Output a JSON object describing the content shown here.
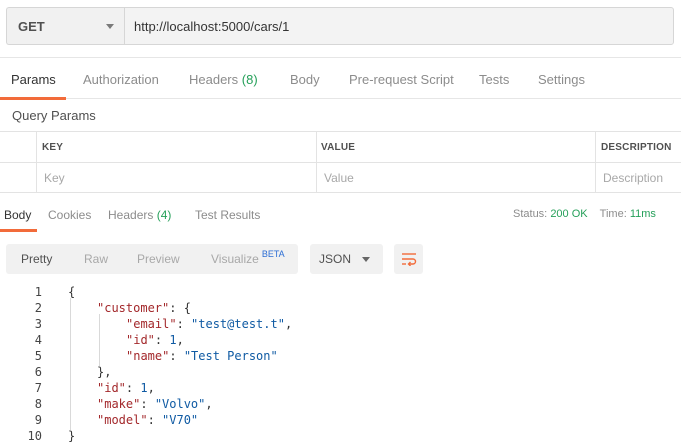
{
  "request": {
    "method": "GET",
    "url": "http://localhost:5000/cars/1"
  },
  "request_tabs": [
    {
      "label": "Params",
      "count": ""
    },
    {
      "label": "Authorization",
      "count": ""
    },
    {
      "label": "Headers",
      "count": "(8)"
    },
    {
      "label": "Body",
      "count": ""
    },
    {
      "label": "Pre-request Script",
      "count": ""
    },
    {
      "label": "Tests",
      "count": ""
    },
    {
      "label": "Settings",
      "count": ""
    }
  ],
  "query_params": {
    "title": "Query Params",
    "headers": [
      "KEY",
      "VALUE",
      "DESCRIPTION"
    ],
    "placeholders": [
      "Key",
      "Value",
      "Description"
    ]
  },
  "response_tabs": [
    {
      "label": "Body",
      "count": ""
    },
    {
      "label": "Cookies",
      "count": ""
    },
    {
      "label": "Headers",
      "count": "(4)"
    },
    {
      "label": "Test Results",
      "count": ""
    }
  ],
  "status": {
    "status_label": "Status:",
    "status_value": "200 OK",
    "time_label": "Time:",
    "time_value": "11ms"
  },
  "format": {
    "options": [
      "Pretty",
      "Raw",
      "Preview",
      "Visualize"
    ],
    "beta": "BETA",
    "selected_type": "JSON"
  },
  "icons": {
    "method_dropdown": "chevron-down-icon",
    "type_dropdown": "chevron-down-icon",
    "wrap": "wrap-lines-icon"
  },
  "colors": {
    "accent": "#f26b3a",
    "status_ok": "#26a05a",
    "beta": "#2d6ed4",
    "json_key": "#a3282b",
    "json_value": "#0f5aa3"
  },
  "code_lines": [
    {
      "n": "1",
      "indent": 0,
      "tokens": [
        {
          "t": "p",
          "v": "{"
        }
      ]
    },
    {
      "n": "2",
      "indent": 1,
      "tokens": [
        {
          "t": "k",
          "v": "\"customer\""
        },
        {
          "t": "p",
          "v": ": {"
        }
      ]
    },
    {
      "n": "3",
      "indent": 2,
      "tokens": [
        {
          "t": "k",
          "v": "\"email\""
        },
        {
          "t": "p",
          "v": ": "
        },
        {
          "t": "s",
          "v": "\"test@test.t\""
        },
        {
          "t": "p",
          "v": ","
        }
      ]
    },
    {
      "n": "4",
      "indent": 2,
      "tokens": [
        {
          "t": "k",
          "v": "\"id\""
        },
        {
          "t": "p",
          "v": ": "
        },
        {
          "t": "n",
          "v": "1"
        },
        {
          "t": "p",
          "v": ","
        }
      ]
    },
    {
      "n": "5",
      "indent": 2,
      "tokens": [
        {
          "t": "k",
          "v": "\"name\""
        },
        {
          "t": "p",
          "v": ": "
        },
        {
          "t": "s",
          "v": "\"Test Person\""
        }
      ]
    },
    {
      "n": "6",
      "indent": 1,
      "tokens": [
        {
          "t": "p",
          "v": "},"
        }
      ]
    },
    {
      "n": "7",
      "indent": 1,
      "tokens": [
        {
          "t": "k",
          "v": "\"id\""
        },
        {
          "t": "p",
          "v": ": "
        },
        {
          "t": "n",
          "v": "1"
        },
        {
          "t": "p",
          "v": ","
        }
      ]
    },
    {
      "n": "8",
      "indent": 1,
      "tokens": [
        {
          "t": "k",
          "v": "\"make\""
        },
        {
          "t": "p",
          "v": ": "
        },
        {
          "t": "s",
          "v": "\"Volvo\""
        },
        {
          "t": "p",
          "v": ","
        }
      ]
    },
    {
      "n": "9",
      "indent": 1,
      "tokens": [
        {
          "t": "k",
          "v": "\"model\""
        },
        {
          "t": "p",
          "v": ": "
        },
        {
          "t": "s",
          "v": "\"V70\""
        }
      ]
    },
    {
      "n": "10",
      "indent": 0,
      "tokens": [
        {
          "t": "p",
          "v": "}"
        }
      ]
    }
  ]
}
